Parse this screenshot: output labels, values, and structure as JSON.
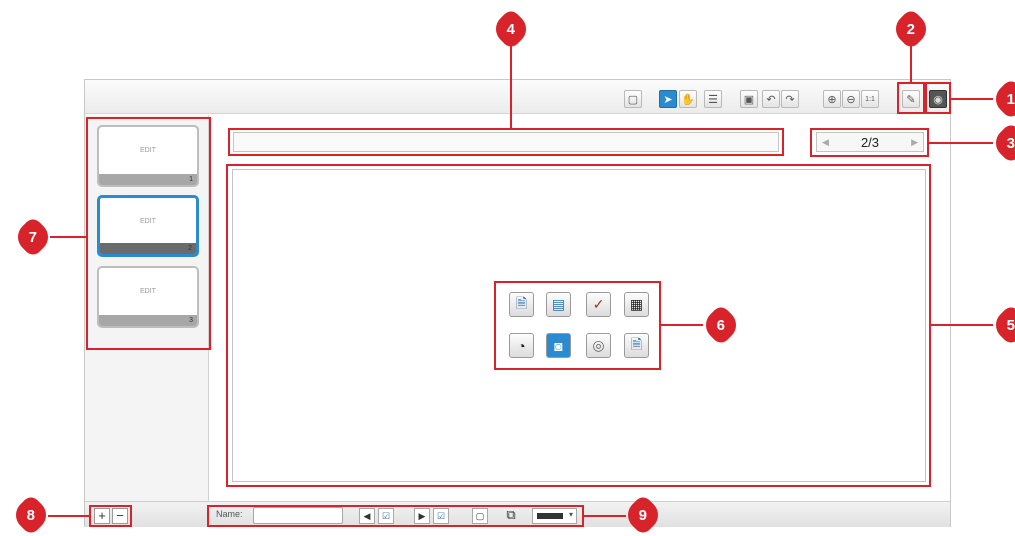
{
  "callouts": {
    "c1": "1",
    "c2": "2",
    "c3": "3",
    "c4": "4",
    "c5": "5",
    "c6": "6",
    "c7": "7",
    "c8": "8",
    "c9": "9"
  },
  "toolbar": {
    "icons": [
      "new-page-icon",
      "select-pointer-icon",
      "hand-pan-icon",
      "list-icon",
      "save-icon",
      "undo-icon",
      "redo-icon",
      "zoom-in-icon",
      "zoom-out-icon",
      "zoom-reset-icon",
      "edit-pencil-icon",
      "camera-mode-icon"
    ],
    "zoom_reset_label": "1:1"
  },
  "pager": {
    "current": "2/3"
  },
  "thumbnails": [
    {
      "label": "EDIT",
      "number": "1"
    },
    {
      "label": "EDIT",
      "number": "2"
    },
    {
      "label": "EDIT",
      "number": "3"
    }
  ],
  "content_tools": [
    "text-icon",
    "image-icon",
    "drawing-icon",
    "movie-icon",
    "sound-icon",
    "camera-icon",
    "webcam-icon",
    "document-icon"
  ],
  "bottom": {
    "add_label": "+",
    "remove_label": "−",
    "name_label": "Name:",
    "name_value": ""
  },
  "colors": {
    "accent": "#d8232a",
    "selected": "#2a8bd0"
  }
}
